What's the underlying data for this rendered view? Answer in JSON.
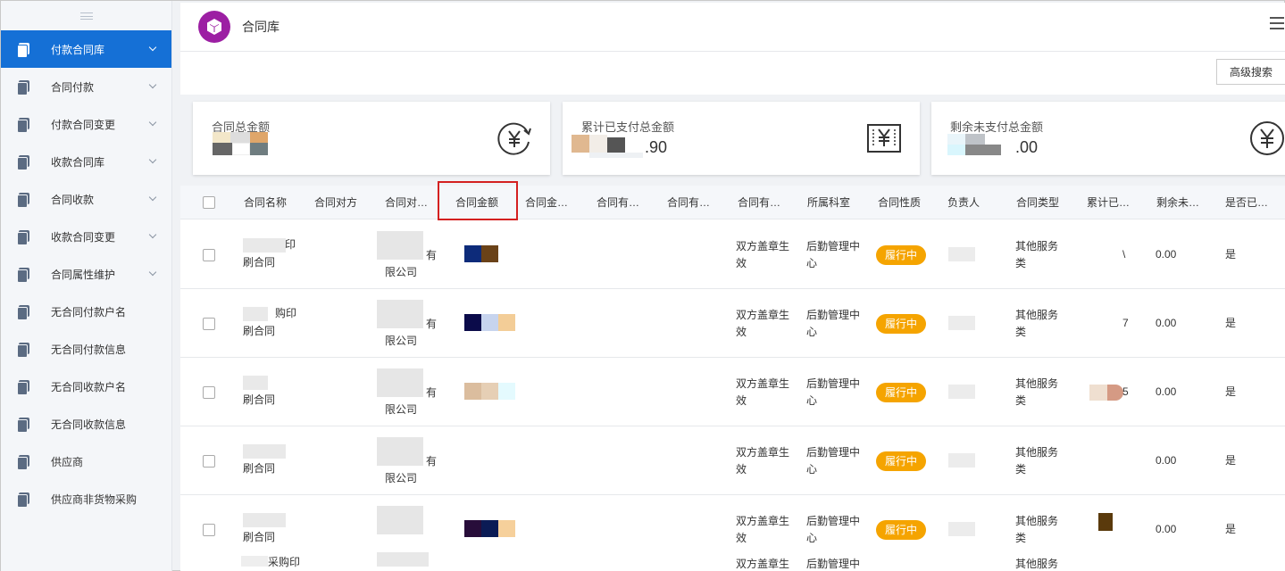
{
  "sidebar": {
    "items": [
      {
        "label": "付款合同库",
        "active": true,
        "has_chevron": true
      },
      {
        "label": "合同付款",
        "has_chevron": true
      },
      {
        "label": "付款合同变更",
        "has_chevron": true
      },
      {
        "label": "收款合同库",
        "has_chevron": true
      },
      {
        "label": "合同收款",
        "has_chevron": true
      },
      {
        "label": "收款合同变更",
        "has_chevron": true
      },
      {
        "label": "合同属性维护",
        "has_chevron": true
      },
      {
        "label": "无合同付款户名",
        "has_chevron": false
      },
      {
        "label": "无合同付款信息",
        "has_chevron": false
      },
      {
        "label": "无合同收款户名",
        "has_chevron": false
      },
      {
        "label": "无合同收款信息",
        "has_chevron": false
      },
      {
        "label": "供应商",
        "has_chevron": false
      },
      {
        "label": "供应商非货物采购",
        "has_chevron": false
      }
    ]
  },
  "header": {
    "title": "合同库"
  },
  "toolbar": {
    "advanced_search": "高级搜索"
  },
  "cards": [
    {
      "label": "合同总金额",
      "value": "",
      "icon": "yen-refresh-icon"
    },
    {
      "label": "累计已支付总金额",
      "value": ".90",
      "icon": "yen-bill-icon"
    },
    {
      "label": "剩余未支付总金额",
      "value": ".00",
      "icon": "yen-circle-icon"
    }
  ],
  "table": {
    "columns": [
      "合同名称",
      "合同对方",
      "合同对…",
      "合同金额",
      "合同金…",
      "合同有…",
      "合同有…",
      "合同有…",
      "所属科室",
      "合同性质",
      "负责人",
      "合同类型",
      "累计已…",
      "剩余未…",
      "是否已…"
    ],
    "rows": [
      {
        "name_l1": "印",
        "name_l2": "刷合同",
        "party_l1": "有",
        "party_l2": "限公司",
        "effect_l1": "双方盖章生",
        "effect_l2": "效",
        "dept_l1": "后勤管理中",
        "dept_l2": "心",
        "status": "履行中",
        "type_l1": "其他服务",
        "type_l2": "类",
        "paid": "\\",
        "remaining": "0.00",
        "done": "是"
      },
      {
        "name_l1": "购印",
        "name_l2": "刷合同",
        "party_l1": "有",
        "party_l2": "限公司",
        "effect_l1": "双方盖章生",
        "effect_l2": "效",
        "dept_l1": "后勤管理中",
        "dept_l2": "心",
        "status": "履行中",
        "type_l1": "其他服务",
        "type_l2": "类",
        "paid": "7",
        "remaining": "0.00",
        "done": "是"
      },
      {
        "name_l1": "",
        "name_l2": "刷合同",
        "party_l1": "有",
        "party_l2": "限公司",
        "effect_l1": "双方盖章生",
        "effect_l2": "效",
        "dept_l1": "后勤管理中",
        "dept_l2": "心",
        "status": "履行中",
        "type_l1": "其他服务",
        "type_l2": "类",
        "paid": "5",
        "remaining": "0.00",
        "done": "是"
      },
      {
        "name_l1": "",
        "name_l2": "刷合同",
        "party_l1": "有",
        "party_l2": "限公司",
        "effect_l1": "双方盖章生",
        "effect_l2": "效",
        "dept_l1": "后勤管理中",
        "dept_l2": "心",
        "status": "履行中",
        "type_l1": "其他服务",
        "type_l2": "类",
        "paid": "",
        "remaining": "0.00",
        "done": "是"
      },
      {
        "name_l1": "",
        "name_l2": "刷合同",
        "party_l1": "",
        "party_l2": "",
        "effect_l1": "双方盖章生",
        "effect_l2": "效",
        "dept_l1": "后勤管理中",
        "dept_l2": "心",
        "status": "履行中",
        "type_l1": "其他服务",
        "type_l2": "类",
        "paid": "",
        "remaining": "0.00",
        "done": "是"
      }
    ],
    "partial_row": {
      "name_l1": "采购印",
      "effect_l1": "双方盖章生",
      "dept_l1": "后勤管理中",
      "type_l1": "其他服务"
    }
  },
  "colors": {
    "accent": "#1570d6",
    "status_badge": "#f5a400",
    "highlight_border": "#d42020",
    "logo": "#9c1fa3"
  }
}
